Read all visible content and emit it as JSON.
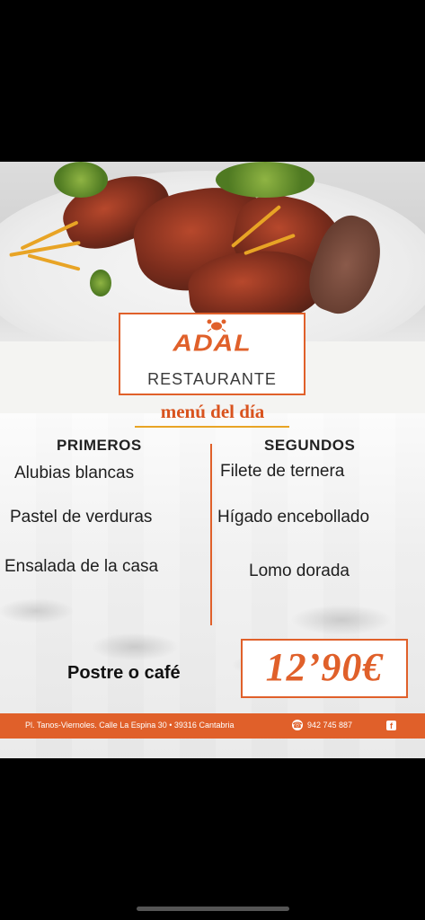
{
  "logo": {
    "name": "ADAL",
    "subtitle": "RESTAURANTE"
  },
  "menu_title": "menú del día",
  "primeros": {
    "heading": "PRIMEROS",
    "items": [
      "Alubias blancas",
      "Pastel de verduras",
      "Ensalada de la casa"
    ]
  },
  "segundos": {
    "heading": "SEGUNDOS",
    "items": [
      "Filete de ternera",
      "Hígado encebollado",
      "Lomo dorada"
    ]
  },
  "postre": "Postre o café",
  "price": "12’90€",
  "footer": {
    "address": "Pl. Tanos-Viernoles. Calle La Espina 30 • 39316 Cantabria",
    "phone": "942 745 887",
    "facebook_icon": "f"
  },
  "colors": {
    "accent": "#e0602a",
    "title": "#d9531e",
    "fries": "#e8a425"
  }
}
